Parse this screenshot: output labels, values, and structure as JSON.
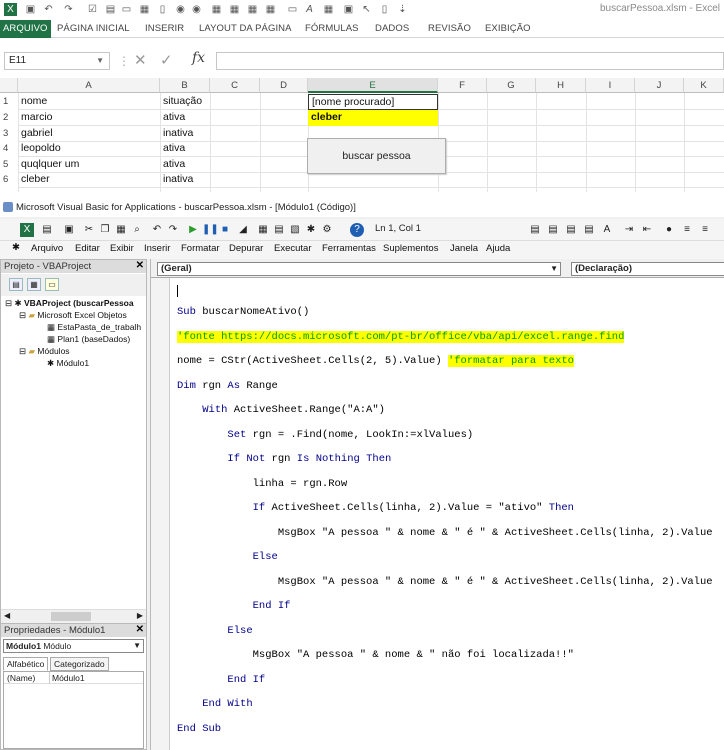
{
  "excel": {
    "title": "buscarPessoa.xlsm - Excel",
    "ribbon_tabs": [
      "ARQUIVO",
      "PÁGINA INICIAL",
      "INSERIR",
      "LAYOUT DA PÁGINA",
      "FÓRMULAS",
      "DADOS",
      "REVISÃO",
      "EXIBIÇÃO"
    ],
    "name_box": "E11",
    "formula_label": "fx",
    "columns": [
      "A",
      "B",
      "C",
      "D",
      "E",
      "F",
      "G",
      "H",
      "I",
      "J",
      "K"
    ],
    "rows": [
      "1",
      "2",
      "3",
      "4",
      "5",
      "6"
    ],
    "cells": {
      "A1": "nome",
      "B1": "situação",
      "E1": "[nome procurado]",
      "A2": "marcio",
      "B2": "ativa",
      "E2": "cleber",
      "A3": "gabriel",
      "B3": "inativa",
      "A4": "leopoldo",
      "B4": "ativa",
      "A5": "quqlquer um",
      "B5": "ativa",
      "A6": "cleber",
      "B6": "inativa"
    },
    "highlight_color": "#ffff00",
    "button_label": "buscar pessoa"
  },
  "vbe": {
    "title": "Microsoft Visual Basic for Applications - buscarPessoa.xlsm - [Módulo1 (Código)]",
    "position": "Ln 1, Col 1",
    "menu": [
      "Arquivo",
      "Editar",
      "Exibir",
      "Inserir",
      "Formatar",
      "Depurar",
      "Executar",
      "Ferramentas",
      "Suplementos",
      "Janela",
      "Ajuda"
    ],
    "project_pane": {
      "title": "Projeto - VBAProject",
      "tree": [
        "VBAProject (buscarPessoa",
        "Microsoft Excel Objetos",
        "EstaPasta_de_trabalh",
        "Plan1 (baseDados)",
        "Módulos",
        "Módulo1"
      ]
    },
    "properties_pane": {
      "title": "Propriedades - Módulo1",
      "object_name": "Módulo1",
      "object_type": "Módulo",
      "tabs": [
        "Alfabético",
        "Categorizado"
      ],
      "rows": [
        {
          "name": "(Name)",
          "value": "Módulo1"
        }
      ]
    },
    "combos": {
      "object": "(Geral)",
      "procedure": "(Declaração)"
    },
    "code_lines": [
      {
        "text": "Sub buscarNomeAtivo()",
        "type": "kw"
      },
      {
        "text": "'fonte https://docs.microsoft.com/pt-br/office/vba/api/excel.range.find",
        "type": "comment"
      },
      {
        "text": "nome = CStr(ActiveSheet.Cells(2, 5).Value) ",
        "type": "plain",
        "comment": "'formatar para texto"
      },
      {
        "text": "Dim rgn As Range",
        "type": "kw"
      },
      {
        "text": "    With ActiveSheet.Range(\"A:A\")",
        "type": "kw"
      },
      {
        "text": "        Set rgn = .Find(nome, LookIn:=xlValues)",
        "type": "kw"
      },
      {
        "text": "        If Not rgn Is Nothing Then",
        "type": "kw"
      },
      {
        "text": "            linha = rgn.Row",
        "type": "plain"
      },
      {
        "text": "            If ActiveSheet.Cells(linha, 2).Value = \"ativo\" Then",
        "type": "kw"
      },
      {
        "text": "                MsgBox \"A pessoa \" & nome & \" é \" & ActiveSheet.Cells(linha, 2).Value",
        "type": "kw"
      },
      {
        "text": "            Else",
        "type": "kw"
      },
      {
        "text": "                MsgBox \"A pessoa \" & nome & \" é \" & ActiveSheet.Cells(linha, 2).Value",
        "type": "kw"
      },
      {
        "text": "            End If",
        "type": "kw"
      },
      {
        "text": "        Else",
        "type": "kw"
      },
      {
        "text": "            MsgBox \"A pessoa \" & nome & \" não foi localizada!!\"",
        "type": "kw"
      },
      {
        "text": "        End If",
        "type": "kw"
      },
      {
        "text": "    End With",
        "type": "kw"
      },
      {
        "text": "End Sub",
        "type": "kw"
      }
    ]
  }
}
